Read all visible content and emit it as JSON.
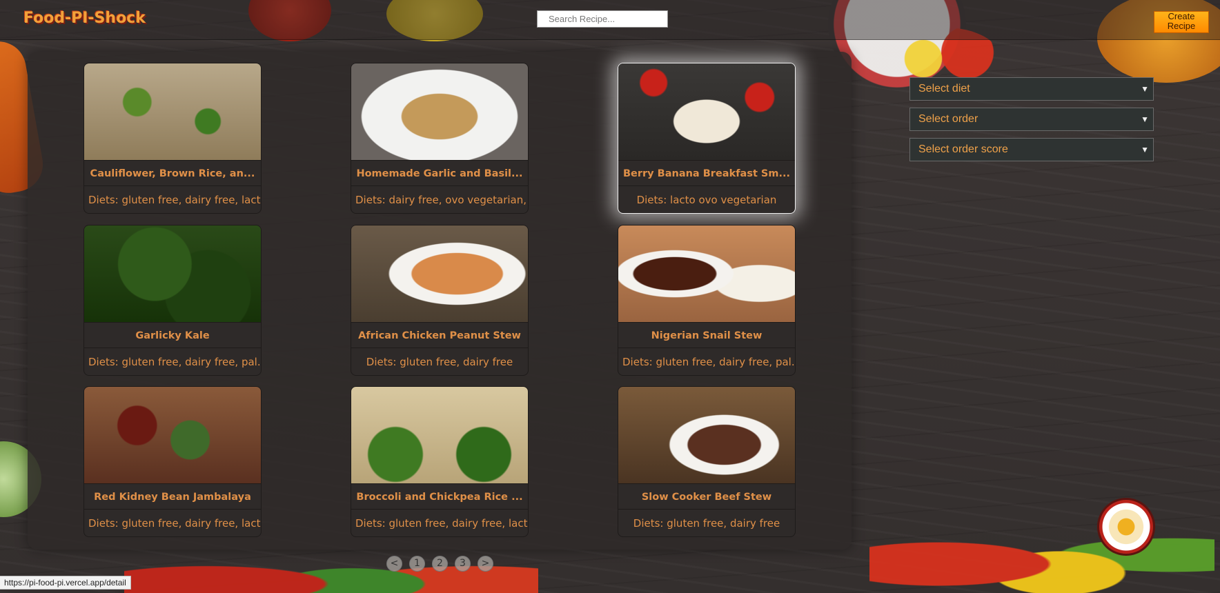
{
  "header": {
    "logo": "Food-PI-Shock",
    "search_placeholder": "Search Recipe...",
    "create_label": "Create Recipe"
  },
  "filters": {
    "diet": "Select diet",
    "order": "Select order",
    "score": "Select order score"
  },
  "recipes": [
    {
      "title": "Cauliflower, Brown Rice, an...",
      "diets": "Diets: gluten free, dairy free, lact..."
    },
    {
      "title": "Homemade Garlic and Basil...",
      "diets": "Diets: dairy free, ovo vegetarian, ..."
    },
    {
      "title": "Berry Banana Breakfast Sm...",
      "diets": "Diets: lacto ovo vegetarian"
    },
    {
      "title": "Garlicky Kale",
      "diets": "Diets: gluten free, dairy free, pal..."
    },
    {
      "title": "African Chicken Peanut Stew",
      "diets": "Diets: gluten free, dairy free"
    },
    {
      "title": "Nigerian Snail Stew",
      "diets": "Diets: gluten free, dairy free, pal..."
    },
    {
      "title": "Red Kidney Bean Jambalaya",
      "diets": "Diets: gluten free, dairy free, lact..."
    },
    {
      "title": "Broccoli and Chickpea Rice ...",
      "diets": "Diets: gluten free, dairy free, lact..."
    },
    {
      "title": "Slow Cooker Beef Stew",
      "diets": "Diets: gluten free, dairy free"
    }
  ],
  "pagination": {
    "prev": "<",
    "pages": [
      "1",
      "2",
      "3"
    ],
    "next": ">"
  },
  "status_url": "https://pi-food-pi.vercel.app/detail",
  "colors": {
    "accent": "#f2a23a",
    "create_button": "#ff9a00",
    "card_bg": "#2e2a29"
  }
}
